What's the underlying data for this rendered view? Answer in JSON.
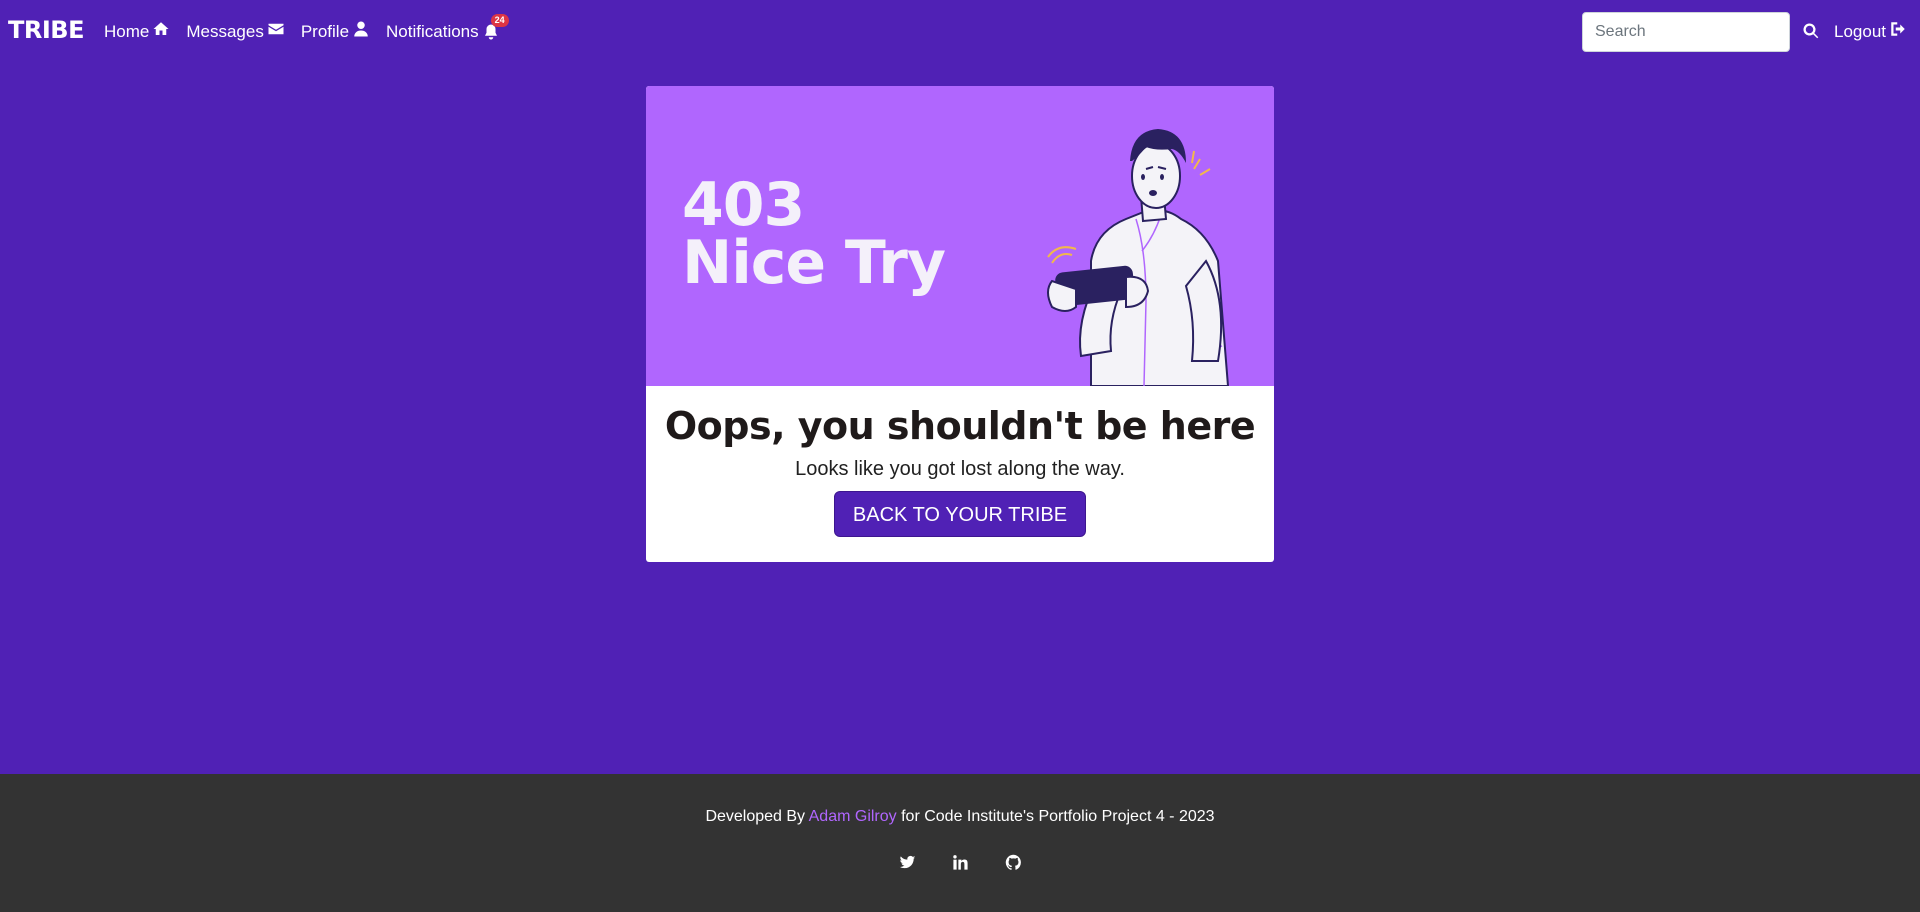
{
  "nav": {
    "brand": "TRIBE",
    "home": "Home",
    "messages": "Messages",
    "profile": "Profile",
    "notifications": "Notifications",
    "notification_count": "24",
    "search_placeholder": "Search",
    "logout": "Logout"
  },
  "error": {
    "code": "403",
    "headline": "Nice Try",
    "title": "Oops, you shouldn't be here",
    "subtitle": "Looks like you got lost along the way.",
    "button": "BACK TO YOUR TRIBE"
  },
  "footer": {
    "prefix": "Developed By",
    "author": "Adam Gilroy",
    "suffix": "for Code Institute's Portfolio Project 4 - 2023",
    "social": [
      "twitter-icon",
      "linkedin-icon",
      "github-icon"
    ]
  },
  "colors": {
    "background": "#5021b5",
    "hero": "#b066fe",
    "footer": "#333333",
    "accent": "#b066fe",
    "badge": "#dc3545"
  }
}
